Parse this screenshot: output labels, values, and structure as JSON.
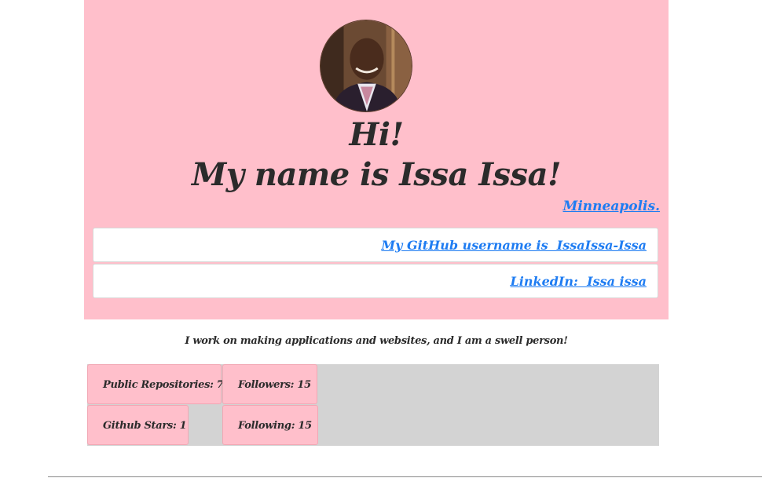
{
  "profile": {
    "greeting": "Hi!",
    "name_line": "My name is Issa Issa!",
    "location": "Minneapolis.",
    "github_link": "My GitHub username is  IssaIssa-Issa",
    "linkedin_link": "LinkedIn:  Issa issa",
    "bio": "I work on making applications and websites, and I am a swell person!"
  },
  "stats": {
    "public_repos": "Public Repositories: 7",
    "followers": "Followers: 15",
    "github_stars": "Github Stars: 1",
    "following": "Following: 15"
  },
  "colors": {
    "hero_background": "#ffbfcb",
    "link": "#1e7cf2",
    "stats_panel": "#d3d3d3",
    "text": "#2b2b2b"
  }
}
